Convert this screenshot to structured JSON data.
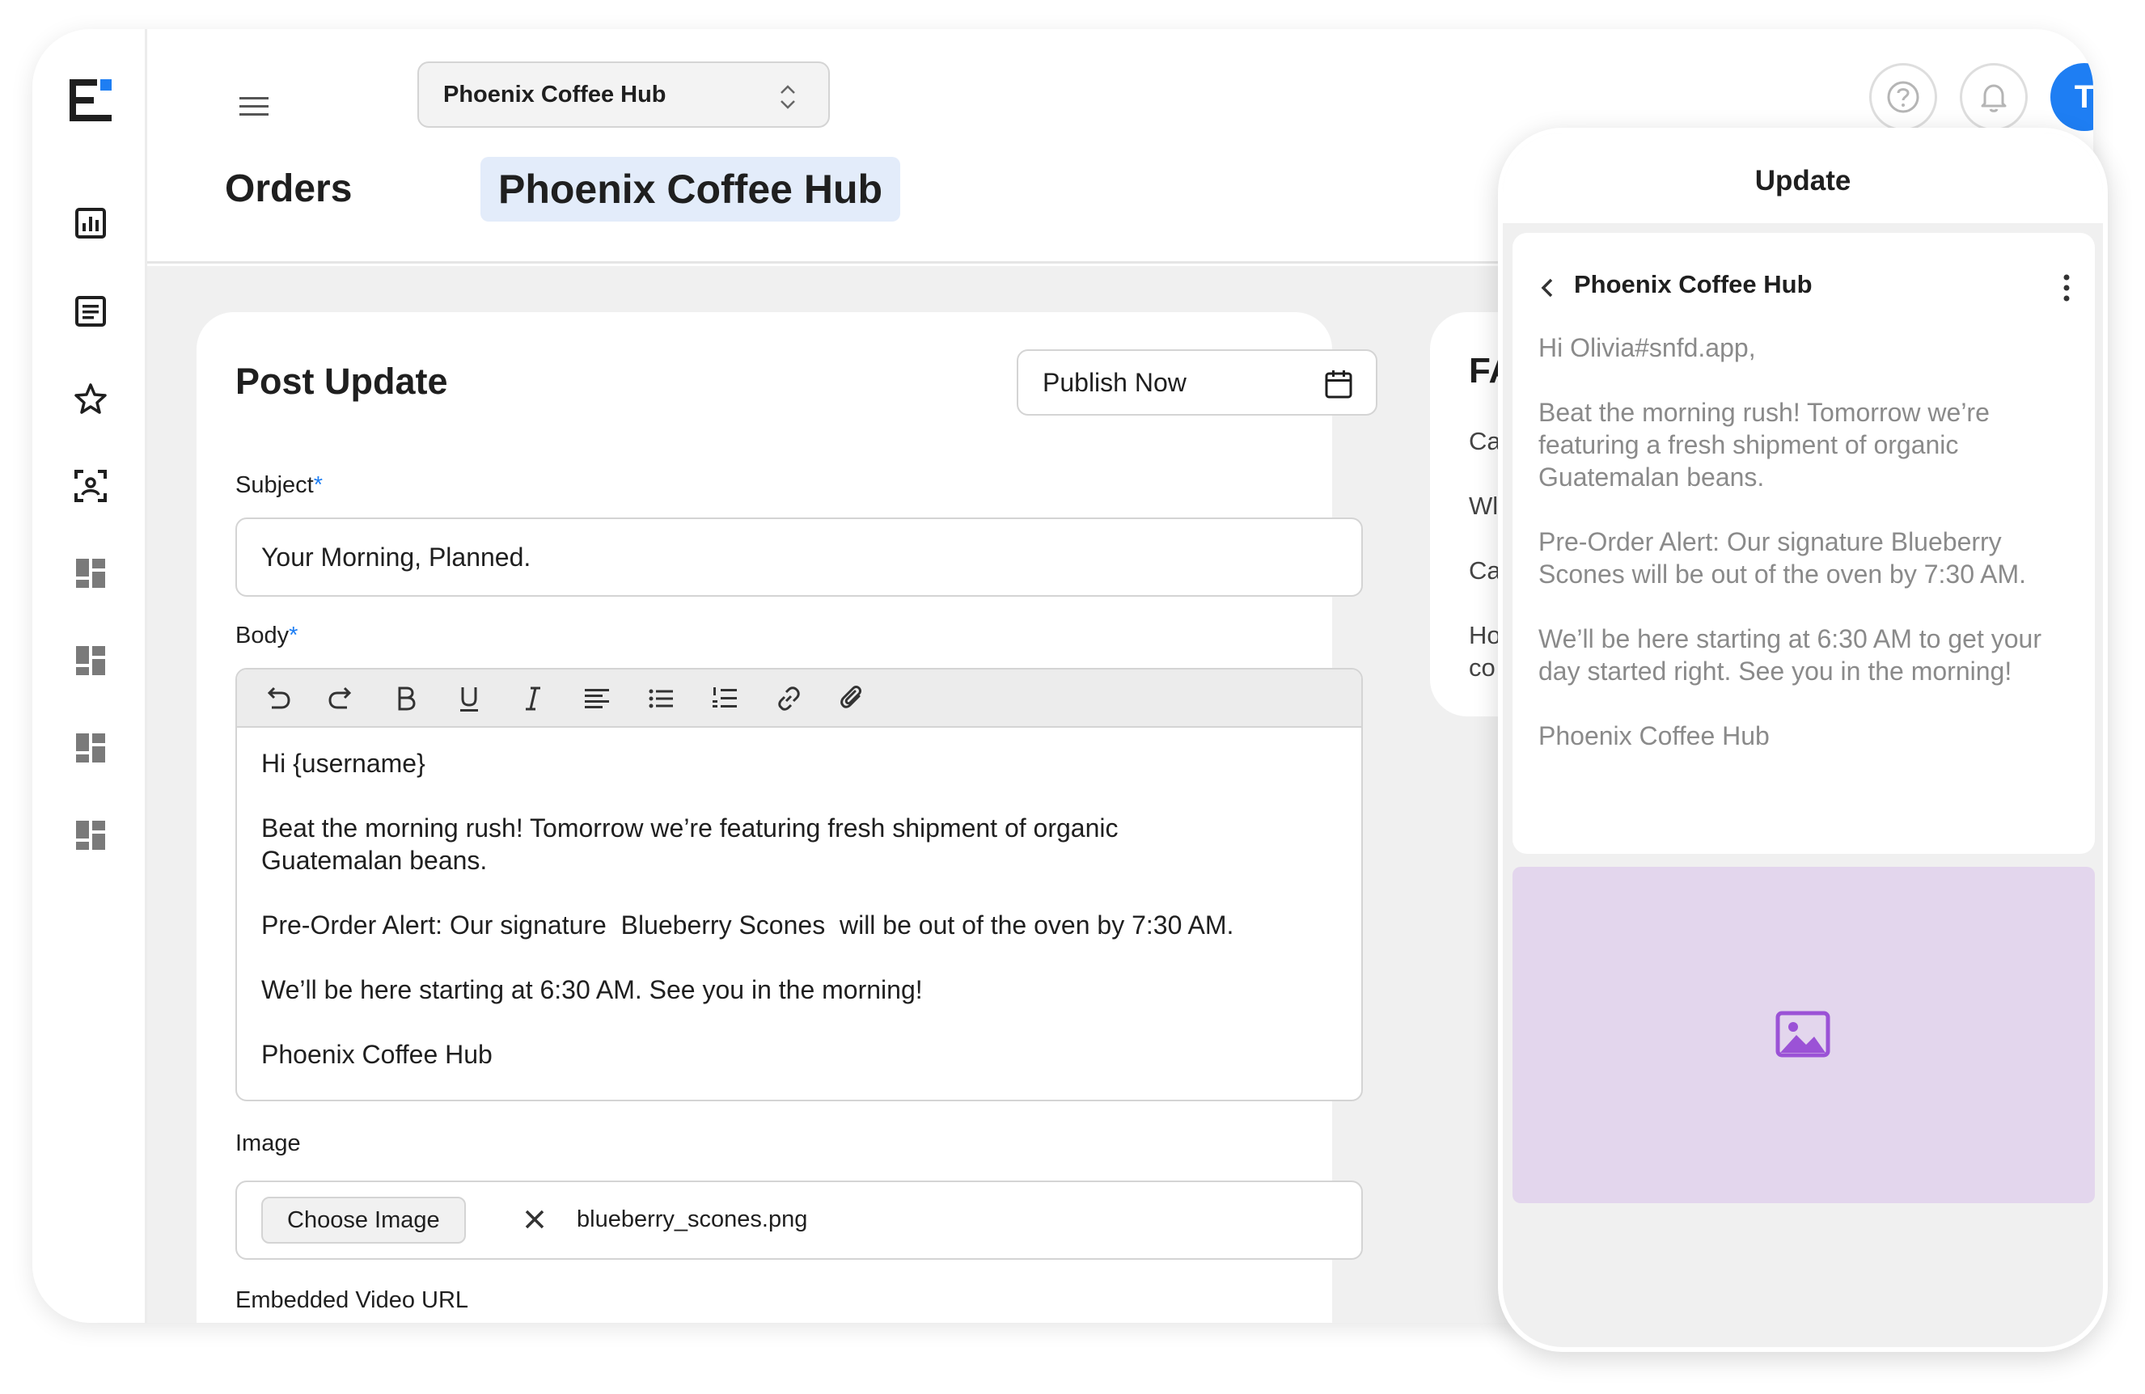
{
  "header": {
    "store_selector_value": "Phoenix Coffee Hub",
    "page_title": "Orders",
    "title_pill": "Phoenix Coffee Hub",
    "avatar_initial": "T"
  },
  "sidebar": {
    "icons": [
      "analytics-icon",
      "document-list-icon",
      "star-icon",
      "user-scan-icon",
      "dashboard-icon",
      "dashboard-icon",
      "dashboard-icon",
      "dashboard-icon"
    ]
  },
  "post_update": {
    "title": "Post Update",
    "publish_value": "Publish Now",
    "subject_label": "Subject",
    "subject_value": "Your Morning, Planned.",
    "body_label": "Body",
    "required_mark": "*",
    "body_paragraphs": [
      "Hi {username}",
      "Beat the morning rush! Tomorrow we’re featuring fresh shipment of organic Guatemalan beans.",
      "Pre-Order Alert: Our signature  Blueberry Scones  will be out of the oven by 7:30 AM.",
      "We’ll be here starting at 6:30 AM. See you in the morning!",
      "Phoenix Coffee Hub"
    ],
    "toolbar_tools": [
      "undo",
      "redo",
      "bold",
      "underline",
      "italic",
      "align-left",
      "bullet-list",
      "numbered-list",
      "link",
      "attachment"
    ],
    "image_label": "Image",
    "choose_image_label": "Choose Image",
    "image_filename": "blueberry_scones.png",
    "video_label": "Embedded Video URL"
  },
  "side_card": {
    "heading": "FA",
    "lines": [
      "Ca",
      "Wl",
      "Ca",
      "Ho",
      "co"
    ]
  },
  "preview": {
    "title": "Update",
    "sender": "Phoenix Coffee Hub",
    "paragraphs": [
      "Hi Olivia#snfd.app,",
      "Beat the morning rush! Tomorrow we’re featuring a fresh shipment of organic Guatemalan beans.",
      "Pre-Order Alert: Our signature Blueberry Scones will be out of the oven by 7:30 AM.",
      "We’ll be here starting at 6:30 AM to get your day started right. See you in the morning!",
      "Phoenix Coffee Hub"
    ]
  },
  "colors": {
    "accent": "#1e7ef3",
    "title_pill_bg": "#e3ecfa",
    "preview_image_bg": "#e3d6ed",
    "preview_image_icon": "#9b52d6"
  }
}
